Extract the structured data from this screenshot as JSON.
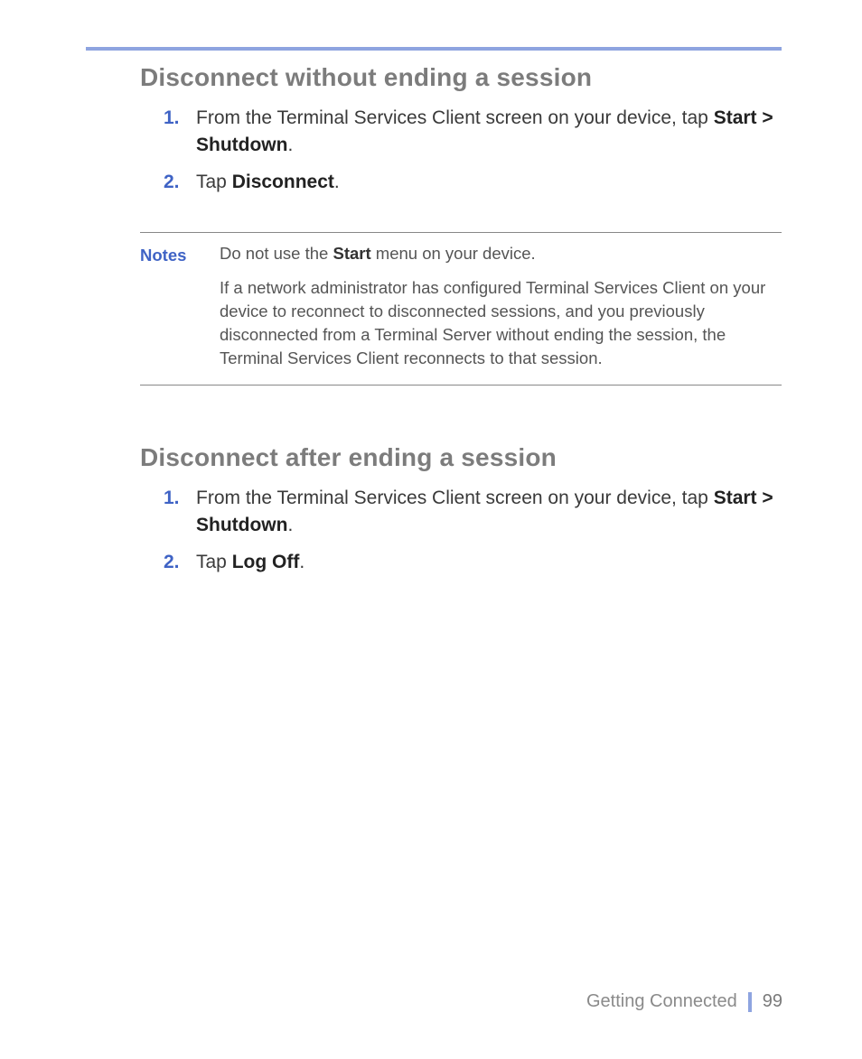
{
  "sections": [
    {
      "heading": "Disconnect without ending a session",
      "steps": [
        {
          "num": "1.",
          "pre": "From the Terminal Services Client screen on your device, tap ",
          "bold": "Start > Shutdown",
          "post": "."
        },
        {
          "num": "2.",
          "pre": "Tap ",
          "bold": "Disconnect",
          "post": "."
        }
      ]
    },
    {
      "heading": "Disconnect after ending a session",
      "steps": [
        {
          "num": "1.",
          "pre": "From the Terminal Services Client screen on your device, tap ",
          "bold": "Start > Shutdown",
          "post": "."
        },
        {
          "num": "2.",
          "pre": "Tap ",
          "bold": "Log Off",
          "post": "."
        }
      ]
    }
  ],
  "notes": {
    "label": "Notes",
    "paras": [
      {
        "pre": "Do not use the ",
        "bold": "Start",
        "post": " menu on your device."
      },
      {
        "pre": "If a network administrator has configured Terminal Services Client on your device to reconnect to disconnected sessions, and you previously disconnected from a Terminal Server without ending the session, the Terminal Services Client reconnects to that session.",
        "bold": "",
        "post": ""
      }
    ]
  },
  "footer": {
    "chapter": "Getting Connected",
    "page": "99"
  }
}
